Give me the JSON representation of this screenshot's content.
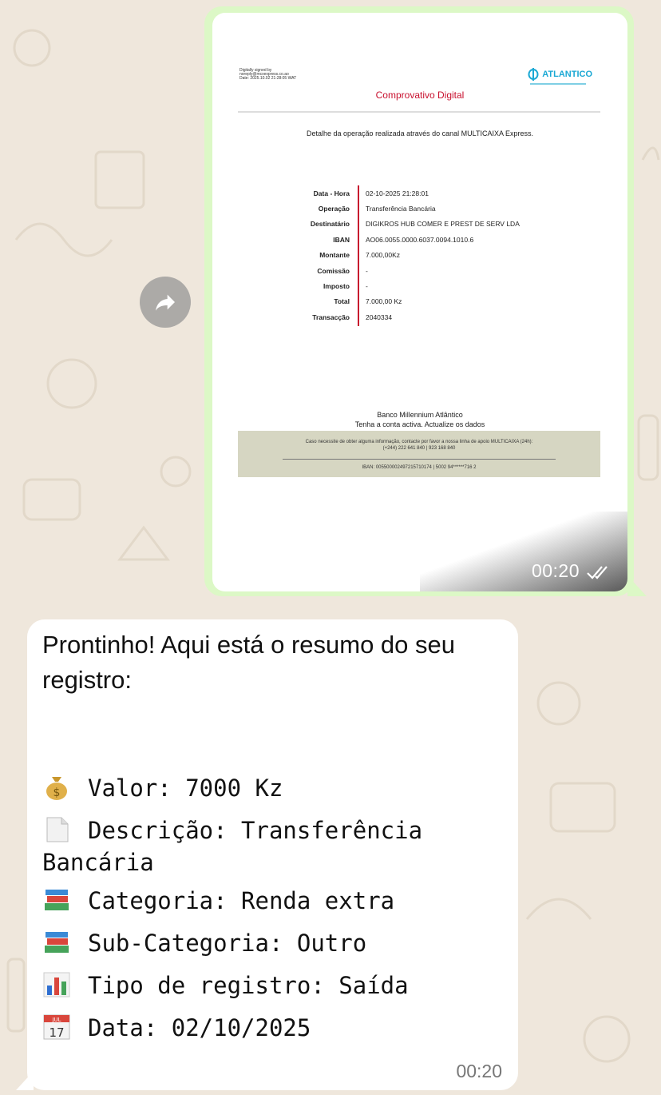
{
  "document": {
    "signature": "Digitally signed by\nnoreply@mcxexpress.co.ao\nDate: 2025.10.02 21:28:05 WAT",
    "logo_text": "ATLANTICO",
    "title": "Comprovativo Digital",
    "intro": "Detalhe da operação realizada através do canal MULTICAIXA Express.",
    "fields": [
      {
        "label": "Data - Hora",
        "value": "02-10-2025 21:28:01"
      },
      {
        "label": "Operação",
        "value": "Transferência Bancária"
      },
      {
        "label": "Destinatário",
        "value": "DIGIKROS HUB COMER E PREST DE SERV LDA"
      },
      {
        "label": "IBAN",
        "value": "AO06.0055.0000.6037.0094.1010.6"
      },
      {
        "label": "Montante",
        "value": "7.000,00Kz"
      },
      {
        "label": "Comissão",
        "value": "-"
      },
      {
        "label": "Imposto",
        "value": "-"
      },
      {
        "label": "Total",
        "value": "7.000,00 Kz"
      },
      {
        "label": "Transacção",
        "value": "2040334"
      }
    ],
    "bank_name": "Banco Millennium Atlântico",
    "slogan": "Tenha a conta activa. Actualize os dados",
    "help_text": "Caso necessite de obter alguma informação, contacte por favor a nossa linha de apoio MULTICAIXA (24h):\n(+244) 222 641 840 | 923 168 840",
    "footer_iban": "IBAN: 005500002497215710174 | 5002 94******716 2"
  },
  "outgoing": {
    "time": "00:20",
    "status_icon": "double-check-icon"
  },
  "incoming": {
    "intro": "Prontinho! Aqui está o resumo do seu registro:",
    "lines": [
      {
        "icon": "money-bag-icon",
        "text": "Valor: 7000 Kz"
      },
      {
        "icon": "page-icon",
        "text": "Descrição: Transferência Bancária"
      },
      {
        "icon": "books-icon",
        "text": "Categoria: Renda extra"
      },
      {
        "icon": "books-icon",
        "text": "Sub-Categoria: Outro"
      },
      {
        "icon": "bar-chart-icon",
        "text": "Tipo de registro: Saída"
      },
      {
        "icon": "calendar-icon",
        "text": "Data: 02/10/2025"
      }
    ],
    "calendar_month": "JUL",
    "calendar_day": "17",
    "time": "00:20"
  },
  "colors": {
    "chat_bg": "#efe7dc",
    "outgoing_bubble": "#dcf8c6",
    "incoming_bubble": "#ffffff",
    "doc_title_red": "#c8102e",
    "logo_blue": "#1aa8d4"
  }
}
